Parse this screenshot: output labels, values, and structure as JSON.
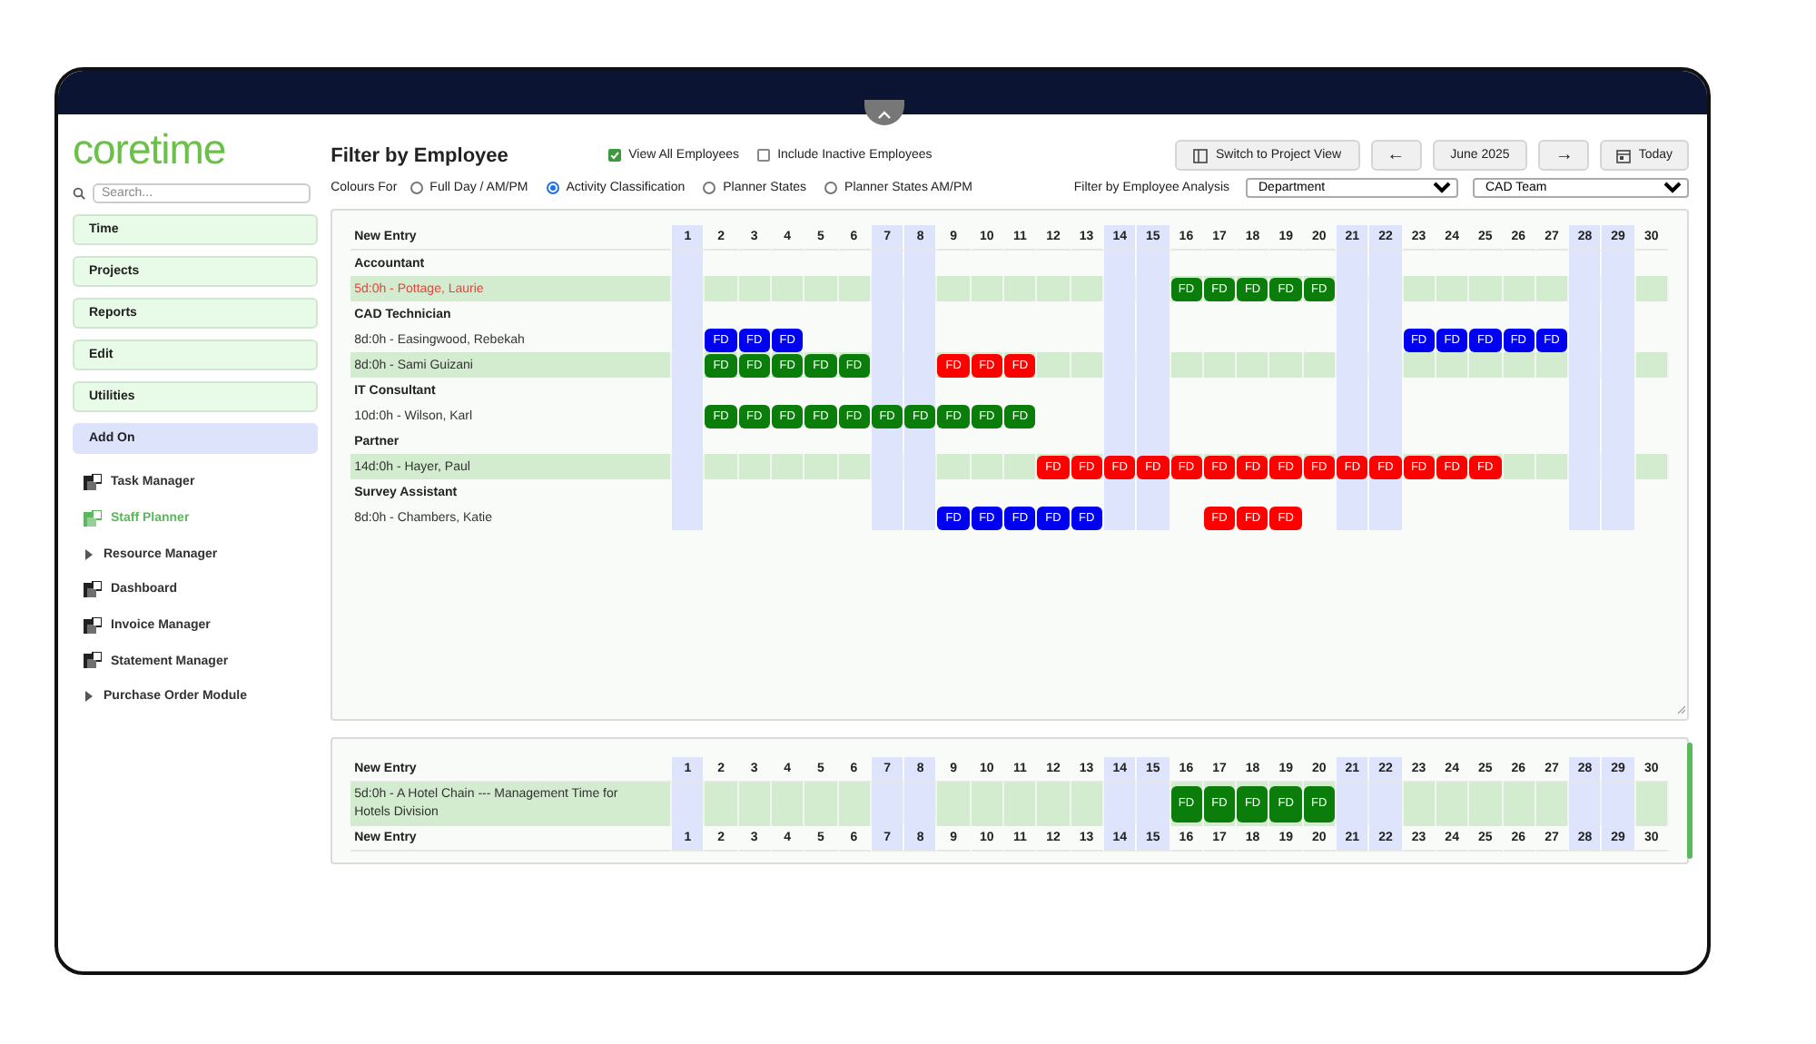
{
  "logo": "coretime",
  "sidebar": {
    "search": {
      "placeholder": "Search..."
    },
    "sections": [
      {
        "label": "Time",
        "selected": false
      },
      {
        "label": "Projects",
        "selected": false
      },
      {
        "label": "Reports",
        "selected": false
      },
      {
        "label": "Edit",
        "selected": false
      },
      {
        "label": "Utilities",
        "selected": false
      },
      {
        "label": "Add On",
        "selected": true
      }
    ],
    "items": [
      {
        "label": "Task Manager",
        "kind": "app",
        "selected": false
      },
      {
        "label": "Staff Planner",
        "kind": "app",
        "selected": true
      },
      {
        "label": "Resource Manager",
        "kind": "folder",
        "selected": false
      },
      {
        "label": "Dashboard",
        "kind": "app",
        "selected": false
      },
      {
        "label": "Invoice Manager",
        "kind": "app",
        "selected": false
      },
      {
        "label": "Statement Manager",
        "kind": "app",
        "selected": false
      },
      {
        "label": "Purchase Order Module",
        "kind": "folder",
        "selected": false
      }
    ]
  },
  "toolbar": {
    "title": "Filter by Employee",
    "checkboxes": [
      {
        "label": "View All Employees",
        "checked": true
      },
      {
        "label": "Include Inactive Employees",
        "checked": false
      }
    ],
    "buttons": [
      {
        "kind": "switch",
        "label": "Switch to Project View"
      },
      {
        "kind": "text",
        "label": "←"
      },
      {
        "kind": "text",
        "label": "June 2025"
      },
      {
        "kind": "text",
        "label": "→"
      },
      {
        "kind": "today",
        "label": "Today"
      }
    ],
    "colours_for": {
      "label": "Colours For",
      "options": [
        {
          "label": "Full Day / AM/PM",
          "selected": false
        },
        {
          "label": "Activity Classification",
          "selected": true
        },
        {
          "label": "Planner States",
          "selected": false
        },
        {
          "label": "Planner States AM/PM",
          "selected": false
        }
      ]
    },
    "analysis": {
      "label": "Filter by Employee Analysis",
      "selects": [
        {
          "value": "Department"
        },
        {
          "value": "CAD Team"
        }
      ]
    }
  },
  "employee_planner": {
    "header": "New Entry",
    "days": [
      {
        "label": "1",
        "weekend": true
      },
      {
        "label": "2",
        "weekend": false
      },
      {
        "label": "3",
        "weekend": false
      },
      {
        "label": "4",
        "weekend": false
      },
      {
        "label": "5",
        "weekend": false
      },
      {
        "label": "6",
        "weekend": false
      },
      {
        "label": "7",
        "weekend": true
      },
      {
        "label": "8",
        "weekend": true
      },
      {
        "label": "9",
        "weekend": false
      },
      {
        "label": "10",
        "weekend": false
      },
      {
        "label": "11",
        "weekend": false
      },
      {
        "label": "12",
        "weekend": false
      },
      {
        "label": "13",
        "weekend": false
      },
      {
        "label": "14",
        "weekend": true
      },
      {
        "label": "15",
        "weekend": true
      },
      {
        "label": "16",
        "weekend": false
      },
      {
        "label": "17",
        "weekend": false
      },
      {
        "label": "18",
        "weekend": false
      },
      {
        "label": "19",
        "weekend": false
      },
      {
        "label": "20",
        "weekend": false
      },
      {
        "label": "21",
        "weekend": true
      },
      {
        "label": "22",
        "weekend": true
      },
      {
        "label": "23",
        "weekend": false
      },
      {
        "label": "24",
        "weekend": false
      },
      {
        "label": "25",
        "weekend": false
      },
      {
        "label": "26",
        "weekend": false
      },
      {
        "label": "27",
        "weekend": false
      },
      {
        "label": "28",
        "weekend": true
      },
      {
        "label": "29",
        "weekend": true
      },
      {
        "label": "30",
        "weekend": false
      }
    ],
    "rows": [
      {
        "kind": "group",
        "label": "Accountant"
      },
      {
        "kind": "employee",
        "label": "5d:0h - Pottage, Laurie",
        "shaded": true,
        "alert": true,
        "cells": [
          null,
          null,
          null,
          null,
          null,
          null,
          null,
          null,
          null,
          null,
          null,
          null,
          null,
          null,
          null,
          {
            "text": "FD",
            "color": "#0a7d0a"
          },
          {
            "text": "FD",
            "color": "#0a7d0a"
          },
          {
            "text": "FD",
            "color": "#0a7d0a"
          },
          {
            "text": "FD",
            "color": "#0a7d0a"
          },
          {
            "text": "FD",
            "color": "#0a7d0a"
          },
          null,
          null,
          null,
          null,
          null,
          null,
          null,
          null,
          null,
          null
        ]
      },
      {
        "kind": "group",
        "label": "CAD Technician"
      },
      {
        "kind": "employee",
        "label": "8d:0h - Easingwood, Rebekah",
        "shaded": false,
        "alert": false,
        "cells": [
          null,
          {
            "text": "FD",
            "color": "#0000f0"
          },
          {
            "text": "FD",
            "color": "#0000f0"
          },
          {
            "text": "FD",
            "color": "#0000f0"
          },
          null,
          null,
          null,
          null,
          null,
          null,
          null,
          null,
          null,
          null,
          null,
          null,
          null,
          null,
          null,
          null,
          null,
          null,
          {
            "text": "FD",
            "color": "#0000f0"
          },
          {
            "text": "FD",
            "color": "#0000f0"
          },
          {
            "text": "FD",
            "color": "#0000f0"
          },
          {
            "text": "FD",
            "color": "#0000f0"
          },
          {
            "text": "FD",
            "color": "#0000f0"
          },
          null,
          null,
          null
        ]
      },
      {
        "kind": "employee",
        "label": "8d:0h - Sami Guizani",
        "shaded": true,
        "alert": false,
        "cells": [
          null,
          {
            "text": "FD",
            "color": "#0a7d0a"
          },
          {
            "text": "FD",
            "color": "#0a7d0a"
          },
          {
            "text": "FD",
            "color": "#0a7d0a"
          },
          {
            "text": "FD",
            "color": "#0a7d0a"
          },
          {
            "text": "FD",
            "color": "#0a7d0a"
          },
          null,
          null,
          {
            "text": "FD",
            "color": "#ff0000"
          },
          {
            "text": "FD",
            "color": "#ff0000"
          },
          {
            "text": "FD",
            "color": "#ff0000"
          },
          null,
          null,
          null,
          null,
          null,
          null,
          null,
          null,
          null,
          null,
          null,
          null,
          null,
          null,
          null,
          null,
          null,
          null,
          null
        ]
      },
      {
        "kind": "group",
        "label": "IT Consultant"
      },
      {
        "kind": "employee",
        "label": "10d:0h - Wilson, Karl",
        "shaded": false,
        "alert": false,
        "cells": [
          null,
          {
            "text": "FD",
            "color": "#0a7d0a"
          },
          {
            "text": "FD",
            "color": "#0a7d0a"
          },
          {
            "text": "FD",
            "color": "#0a7d0a"
          },
          {
            "text": "FD",
            "color": "#0a7d0a"
          },
          {
            "text": "FD",
            "color": "#0a7d0a"
          },
          {
            "text": "FD",
            "color": "#0a7d0a"
          },
          {
            "text": "FD",
            "color": "#0a7d0a"
          },
          {
            "text": "FD",
            "color": "#0a7d0a"
          },
          {
            "text": "FD",
            "color": "#0a7d0a"
          },
          {
            "text": "FD",
            "color": "#0a7d0a"
          },
          null,
          null,
          null,
          null,
          null,
          null,
          null,
          null,
          null,
          null,
          null,
          null,
          null,
          null,
          null,
          null,
          null,
          null,
          null
        ]
      },
      {
        "kind": "group",
        "label": "Partner"
      },
      {
        "kind": "employee",
        "label": "14d:0h - Hayer, Paul",
        "shaded": true,
        "alert": false,
        "cells": [
          null,
          null,
          null,
          null,
          null,
          null,
          null,
          null,
          null,
          null,
          null,
          {
            "text": "FD",
            "color": "#ff0000"
          },
          {
            "text": "FD",
            "color": "#ff0000"
          },
          {
            "text": "FD",
            "color": "#ff0000"
          },
          {
            "text": "FD",
            "color": "#ff0000"
          },
          {
            "text": "FD",
            "color": "#ff0000"
          },
          {
            "text": "FD",
            "color": "#ff0000"
          },
          {
            "text": "FD",
            "color": "#ff0000"
          },
          {
            "text": "FD",
            "color": "#ff0000"
          },
          {
            "text": "FD",
            "color": "#ff0000"
          },
          {
            "text": "FD",
            "color": "#ff0000"
          },
          {
            "text": "FD",
            "color": "#ff0000"
          },
          {
            "text": "FD",
            "color": "#ff0000"
          },
          {
            "text": "FD",
            "color": "#ff0000"
          },
          {
            "text": "FD",
            "color": "#ff0000"
          },
          null,
          null,
          null,
          null,
          null
        ]
      },
      {
        "kind": "group",
        "label": "Survey Assistant"
      },
      {
        "kind": "employee",
        "label": "8d:0h - Chambers, Katie",
        "shaded": false,
        "alert": false,
        "cells": [
          null,
          null,
          null,
          null,
          null,
          null,
          null,
          null,
          {
            "text": "FD",
            "color": "#0000f0"
          },
          {
            "text": "FD",
            "color": "#0000f0"
          },
          {
            "text": "FD",
            "color": "#0000f0"
          },
          {
            "text": "FD",
            "color": "#0000f0"
          },
          {
            "text": "FD",
            "color": "#0000f0"
          },
          null,
          null,
          null,
          {
            "text": "FD",
            "color": "#ff0000"
          },
          {
            "text": "FD",
            "color": "#ff0000"
          },
          {
            "text": "FD",
            "color": "#ff0000"
          },
          null,
          null,
          null,
          null,
          null,
          null,
          null,
          null,
          null,
          null,
          null
        ]
      }
    ]
  },
  "project_planner": {
    "header": "New Entry",
    "days": [
      {
        "label": "1",
        "weekend": true
      },
      {
        "label": "2",
        "weekend": false
      },
      {
        "label": "3",
        "weekend": false
      },
      {
        "label": "4",
        "weekend": false
      },
      {
        "label": "5",
        "weekend": false
      },
      {
        "label": "6",
        "weekend": false
      },
      {
        "label": "7",
        "weekend": true
      },
      {
        "label": "8",
        "weekend": true
      },
      {
        "label": "9",
        "weekend": false
      },
      {
        "label": "10",
        "weekend": false
      },
      {
        "label": "11",
        "weekend": false
      },
      {
        "label": "12",
        "weekend": false
      },
      {
        "label": "13",
        "weekend": false
      },
      {
        "label": "14",
        "weekend": true
      },
      {
        "label": "15",
        "weekend": true
      },
      {
        "label": "16",
        "weekend": false
      },
      {
        "label": "17",
        "weekend": false
      },
      {
        "label": "18",
        "weekend": false
      },
      {
        "label": "19",
        "weekend": false
      },
      {
        "label": "20",
        "weekend": false
      },
      {
        "label": "21",
        "weekend": true
      },
      {
        "label": "22",
        "weekend": true
      },
      {
        "label": "23",
        "weekend": false
      },
      {
        "label": "24",
        "weekend": false
      },
      {
        "label": "25",
        "weekend": false
      },
      {
        "label": "26",
        "weekend": false
      },
      {
        "label": "27",
        "weekend": false
      },
      {
        "label": "28",
        "weekend": true
      },
      {
        "label": "29",
        "weekend": true
      },
      {
        "label": "30",
        "weekend": false
      }
    ],
    "rows": [
      {
        "kind": "employee",
        "label": "5d:0h - A Hotel Chain --- Management Time for Hotels Division",
        "shaded": true,
        "alert": false,
        "cells": [
          null,
          null,
          null,
          null,
          null,
          null,
          null,
          null,
          null,
          null,
          null,
          null,
          null,
          null,
          null,
          {
            "text": "FD",
            "color": "#0a7d0a"
          },
          {
            "text": "FD",
            "color": "#0a7d0a"
          },
          {
            "text": "FD",
            "color": "#0a7d0a"
          },
          {
            "text": "FD",
            "color": "#0a7d0a"
          },
          {
            "text": "FD",
            "color": "#0a7d0a"
          },
          null,
          null,
          null,
          null,
          null,
          null,
          null,
          null,
          null,
          null
        ]
      }
    ],
    "footer": "New Entry",
    "footer_days": [
      {
        "label": "1",
        "weekend": true
      },
      {
        "label": "2",
        "weekend": false
      },
      {
        "label": "3",
        "weekend": false
      },
      {
        "label": "4",
        "weekend": false
      },
      {
        "label": "5",
        "weekend": false
      },
      {
        "label": "6",
        "weekend": false
      },
      {
        "label": "7",
        "weekend": true
      },
      {
        "label": "8",
        "weekend": true
      },
      {
        "label": "9",
        "weekend": false
      },
      {
        "label": "10",
        "weekend": false
      },
      {
        "label": "11",
        "weekend": false
      },
      {
        "label": "12",
        "weekend": false
      },
      {
        "label": "13",
        "weekend": false
      },
      {
        "label": "14",
        "weekend": true
      },
      {
        "label": "15",
        "weekend": true
      },
      {
        "label": "16",
        "weekend": false
      },
      {
        "label": "17",
        "weekend": false
      },
      {
        "label": "18",
        "weekend": false
      },
      {
        "label": "19",
        "weekend": false
      },
      {
        "label": "20",
        "weekend": false
      },
      {
        "label": "21",
        "weekend": true
      },
      {
        "label": "22",
        "weekend": true
      },
      {
        "label": "23",
        "weekend": false
      },
      {
        "label": "24",
        "weekend": false
      },
      {
        "label": "25",
        "weekend": false
      },
      {
        "label": "26",
        "weekend": false
      },
      {
        "label": "27",
        "weekend": false
      },
      {
        "label": "28",
        "weekend": true
      },
      {
        "label": "29",
        "weekend": true
      },
      {
        "label": "30",
        "weekend": false
      }
    ]
  }
}
